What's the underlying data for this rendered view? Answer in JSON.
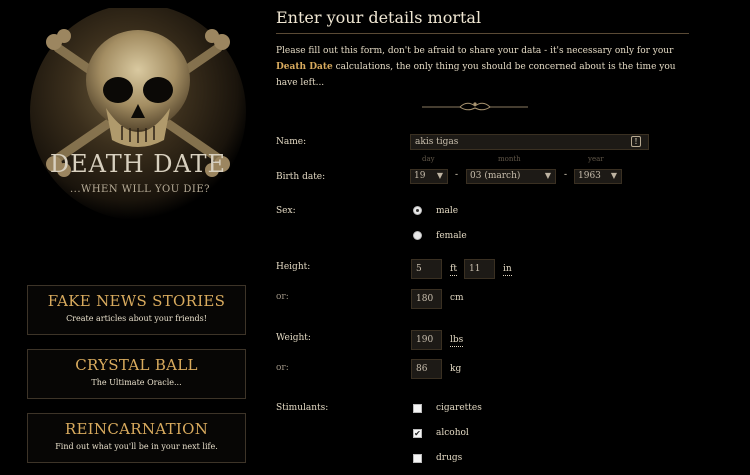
{
  "sidebar": {
    "logo_title": "DEATH DATE",
    "logo_subtitle": "...WHEN WILL YOU DIE?",
    "promos": [
      {
        "title": "FAKE NEWS STORIES",
        "subtitle": "Create articles about your friends!"
      },
      {
        "title": "CRYSTAL BALL",
        "subtitle": "The Ultimate Oracle..."
      },
      {
        "title": "REINCARNATION",
        "subtitle": "Find out what you'll be in your next life."
      }
    ]
  },
  "main": {
    "title": "Enter your details mortal",
    "intro_1": "Please fill out this form, don't be afraid to share your data - it's necessary only for your",
    "intro_highlight": "Death Date",
    "intro_2": "calculations, the only thing you should be concerned about is the time you have left..."
  },
  "form": {
    "name": {
      "label": "Name:",
      "value": "akis tigas"
    },
    "birth": {
      "label": "Birth date:",
      "day_label": "day",
      "month_label": "month",
      "year_label": "year",
      "day": "19",
      "month": "03 (march)",
      "year": "1963"
    },
    "sex": {
      "label": "Sex:",
      "options": [
        "male",
        "female"
      ],
      "selected": "male"
    },
    "height": {
      "label": "Height:",
      "ft": "5",
      "ft_unit": "ft",
      "in": "11",
      "in_unit": "in",
      "or_label": "or:",
      "cm": "180",
      "cm_unit": "cm"
    },
    "weight": {
      "label": "Weight:",
      "lbs": "190",
      "lbs_unit": "lbs",
      "or_label": "or:",
      "kg": "86",
      "kg_unit": "kg"
    },
    "stimulants": {
      "label": "Stimulants:",
      "options": [
        {
          "label": "cigarettes",
          "checked": false
        },
        {
          "label": "alcohol",
          "checked": true
        },
        {
          "label": "drugs",
          "checked": false
        }
      ]
    }
  }
}
